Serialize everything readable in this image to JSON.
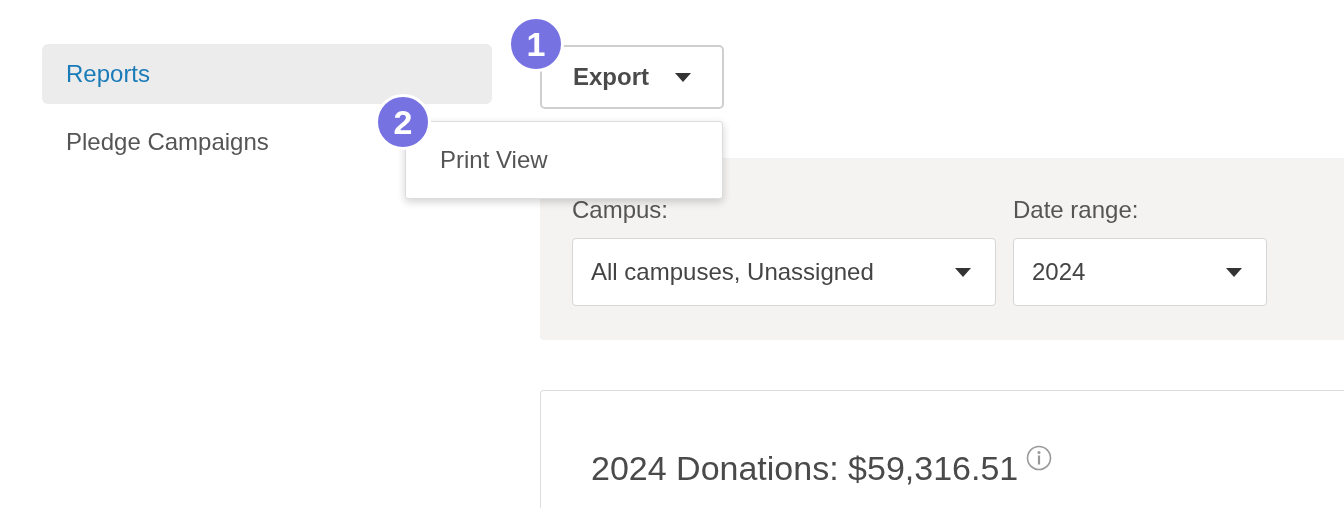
{
  "sidebar": {
    "items": [
      {
        "label": "Reports",
        "selected": true
      },
      {
        "label": "Pledge Campaigns",
        "selected": false
      }
    ]
  },
  "export_button": {
    "label": "Export",
    "callout": "1"
  },
  "export_menu": {
    "open": true,
    "callout": "2",
    "items": [
      "Print View"
    ]
  },
  "filters": [
    {
      "label": "Campus:",
      "value": "All campuses, Unassigned"
    },
    {
      "label": "Date range:",
      "value": "2024"
    }
  ],
  "summary": {
    "title": "2024 Donations: $59,316.51"
  }
}
